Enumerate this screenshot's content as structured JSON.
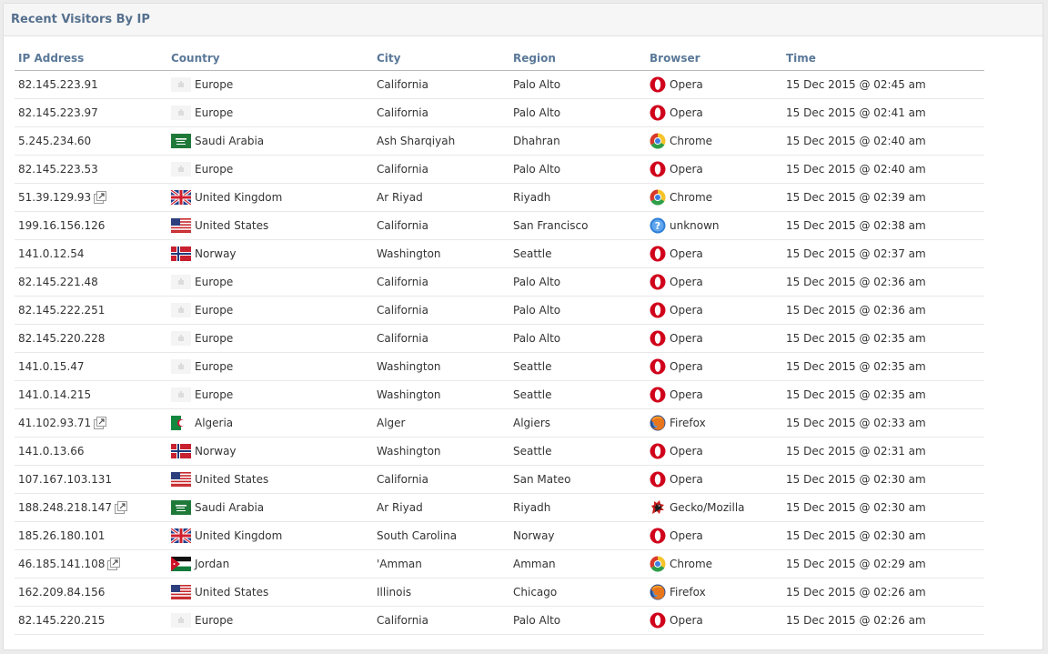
{
  "panel": {
    "title": "Recent Visitors By IP"
  },
  "table": {
    "headers": {
      "ip": "IP Address",
      "country": "Country",
      "city": "City",
      "region": "Region",
      "browser": "Browser",
      "time": "Time"
    },
    "rows": [
      {
        "ip": "82.145.223.91",
        "ext": false,
        "flag": "europe-flag-icon",
        "country": "Europe",
        "city": "California",
        "region": "Palo Alto",
        "browser_icon": "opera-icon",
        "browser": "Opera",
        "time": "15 Dec 2015 @ 02:45 am"
      },
      {
        "ip": "82.145.223.97",
        "ext": false,
        "flag": "europe-flag-icon",
        "country": "Europe",
        "city": "California",
        "region": "Palo Alto",
        "browser_icon": "opera-icon",
        "browser": "Opera",
        "time": "15 Dec 2015 @ 02:41 am"
      },
      {
        "ip": "5.245.234.60",
        "ext": false,
        "flag": "saudi-arabia-flag-icon",
        "country": "Saudi Arabia",
        "city": "Ash Sharqiyah",
        "region": "Dhahran",
        "browser_icon": "chrome-icon",
        "browser": "Chrome",
        "time": "15 Dec 2015 @ 02:40 am"
      },
      {
        "ip": "82.145.223.53",
        "ext": false,
        "flag": "europe-flag-icon",
        "country": "Europe",
        "city": "California",
        "region": "Palo Alto",
        "browser_icon": "opera-icon",
        "browser": "Opera",
        "time": "15 Dec 2015 @ 02:40 am"
      },
      {
        "ip": "51.39.129.93",
        "ext": true,
        "flag": "united-kingdom-flag-icon",
        "country": "United Kingdom",
        "city": "Ar Riyad",
        "region": "Riyadh",
        "browser_icon": "chrome-icon",
        "browser": "Chrome",
        "time": "15 Dec 2015 @ 02:39 am"
      },
      {
        "ip": "199.16.156.126",
        "ext": false,
        "flag": "united-states-flag-icon",
        "country": "United States",
        "city": "California",
        "region": "San Francisco",
        "browser_icon": "unknown-browser-icon",
        "browser": "unknown",
        "time": "15 Dec 2015 @ 02:38 am"
      },
      {
        "ip": "141.0.12.54",
        "ext": false,
        "flag": "norway-flag-icon",
        "country": "Norway",
        "city": "Washington",
        "region": "Seattle",
        "browser_icon": "opera-icon",
        "browser": "Opera",
        "time": "15 Dec 2015 @ 02:37 am"
      },
      {
        "ip": "82.145.221.48",
        "ext": false,
        "flag": "europe-flag-icon",
        "country": "Europe",
        "city": "California",
        "region": "Palo Alto",
        "browser_icon": "opera-icon",
        "browser": "Opera",
        "time": "15 Dec 2015 @ 02:36 am"
      },
      {
        "ip": "82.145.222.251",
        "ext": false,
        "flag": "europe-flag-icon",
        "country": "Europe",
        "city": "California",
        "region": "Palo Alto",
        "browser_icon": "opera-icon",
        "browser": "Opera",
        "time": "15 Dec 2015 @ 02:36 am"
      },
      {
        "ip": "82.145.220.228",
        "ext": false,
        "flag": "europe-flag-icon",
        "country": "Europe",
        "city": "California",
        "region": "Palo Alto",
        "browser_icon": "opera-icon",
        "browser": "Opera",
        "time": "15 Dec 2015 @ 02:35 am"
      },
      {
        "ip": "141.0.15.47",
        "ext": false,
        "flag": "europe-flag-icon",
        "country": "Europe",
        "city": "Washington",
        "region": "Seattle",
        "browser_icon": "opera-icon",
        "browser": "Opera",
        "time": "15 Dec 2015 @ 02:35 am"
      },
      {
        "ip": "141.0.14.215",
        "ext": false,
        "flag": "europe-flag-icon",
        "country": "Europe",
        "city": "Washington",
        "region": "Seattle",
        "browser_icon": "opera-icon",
        "browser": "Opera",
        "time": "15 Dec 2015 @ 02:35 am"
      },
      {
        "ip": "41.102.93.71",
        "ext": true,
        "flag": "algeria-flag-icon",
        "country": "Algeria",
        "city": "Alger",
        "region": "Algiers",
        "browser_icon": "firefox-icon",
        "browser": "Firefox",
        "time": "15 Dec 2015 @ 02:33 am"
      },
      {
        "ip": "141.0.13.66",
        "ext": false,
        "flag": "norway-flag-icon",
        "country": "Norway",
        "city": "Washington",
        "region": "Seattle",
        "browser_icon": "opera-icon",
        "browser": "Opera",
        "time": "15 Dec 2015 @ 02:31 am"
      },
      {
        "ip": "107.167.103.131",
        "ext": false,
        "flag": "united-states-flag-icon",
        "country": "United States",
        "city": "California",
        "region": "San Mateo",
        "browser_icon": "opera-icon",
        "browser": "Opera",
        "time": "15 Dec 2015 @ 02:30 am"
      },
      {
        "ip": "188.248.218.147",
        "ext": true,
        "flag": "saudi-arabia-flag-icon",
        "country": "Saudi Arabia",
        "city": "Ar Riyad",
        "region": "Riyadh",
        "browser_icon": "gecko-mozilla-icon",
        "browser": "Gecko/Mozilla",
        "time": "15 Dec 2015 @ 02:30 am"
      },
      {
        "ip": "185.26.180.101",
        "ext": false,
        "flag": "united-kingdom-flag-icon",
        "country": "United Kingdom",
        "city": "South Carolina",
        "region": "Norway",
        "browser_icon": "opera-icon",
        "browser": "Opera",
        "time": "15 Dec 2015 @ 02:30 am"
      },
      {
        "ip": "46.185.141.108",
        "ext": true,
        "flag": "jordan-flag-icon",
        "country": "Jordan",
        "city": "'Amman",
        "region": "Amman",
        "browser_icon": "chrome-icon",
        "browser": "Chrome",
        "time": "15 Dec 2015 @ 02:29 am"
      },
      {
        "ip": "162.209.84.156",
        "ext": false,
        "flag": "united-states-flag-icon",
        "country": "United States",
        "city": "Illinois",
        "region": "Chicago",
        "browser_icon": "firefox-icon",
        "browser": "Firefox",
        "time": "15 Dec 2015 @ 02:26 am"
      },
      {
        "ip": "82.145.220.215",
        "ext": false,
        "flag": "europe-flag-icon",
        "country": "Europe",
        "city": "California",
        "region": "Palo Alto",
        "browser_icon": "opera-icon",
        "browser": "Opera",
        "time": "15 Dec 2015 @ 02:26 am"
      }
    ]
  },
  "colors": {
    "header_text": "#5a7898",
    "title_text": "#55708e",
    "body_text": "#333333",
    "opera_red": "#d0021b",
    "chrome_green": "#2e9e48",
    "chrome_yellow": "#f6c42a",
    "chrome_red": "#d8392b",
    "chrome_blue": "#3d7fe0"
  }
}
